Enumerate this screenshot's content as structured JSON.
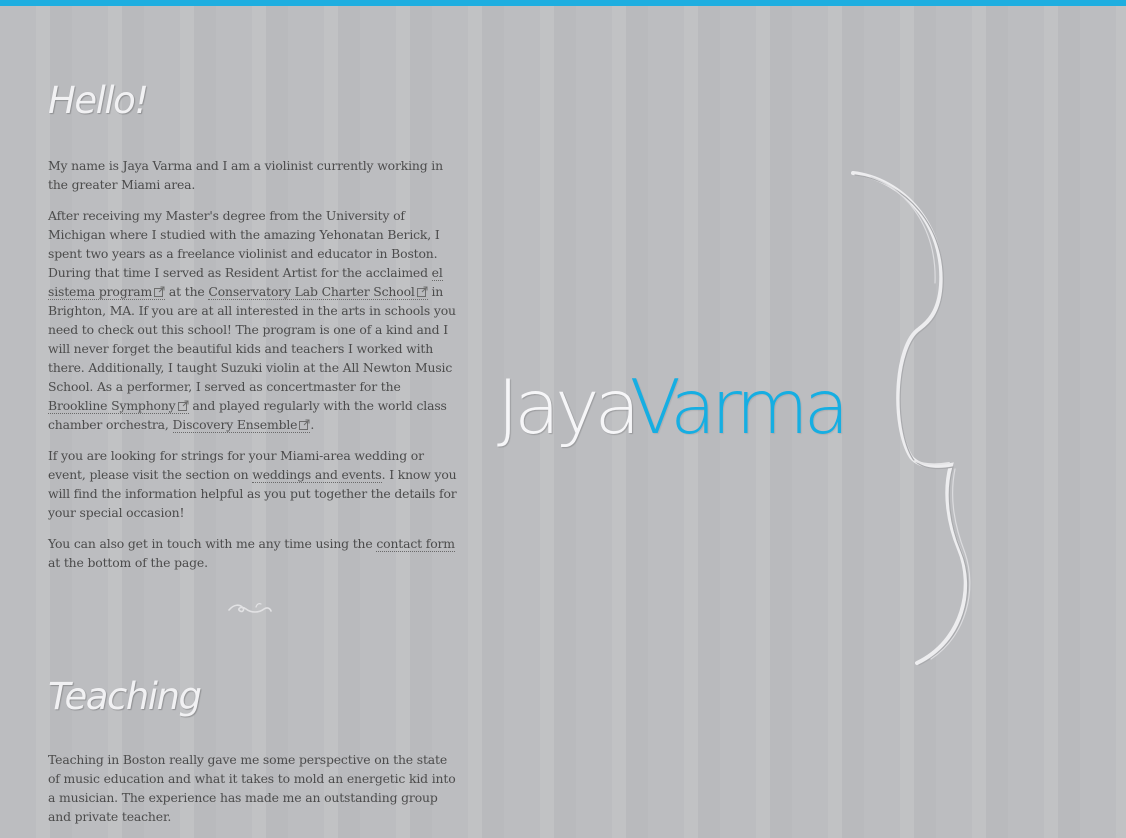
{
  "colors": {
    "accent": "#1eaee0",
    "background": "#bcbdc0",
    "heading": "#f1f1f3",
    "body_text": "#4b4b4b"
  },
  "logo": {
    "first": "Jaya",
    "last": "Varma"
  },
  "hello": {
    "heading": "Hello!",
    "p1": "My name is Jaya Varma and I am a violinist currently working in the greater Miami area.",
    "p2": {
      "t1": "After receiving my Master's degree from the University of Michigan where I studied with the amazing Yehonatan Berick, I spent two years as a freelance violinist and educator in Boston. During that time I served as Resident Artist for the acclaimed ",
      "link1": "el sistema program",
      "t2": " at the ",
      "link2": "Conservatory Lab Charter School",
      "t3": " in Brighton, MA. If you are at all interested in the arts in schools you need to check out this school! The program is one of a kind and I will never forget the beautiful kids and teachers I worked with there. Additionally, I taught Suzuki violin at the All Newton Music School. As a performer, I served as concertmaster for the ",
      "link3": "Brookline Symphony",
      "t4": " and played regularly with the world class chamber orchestra, ",
      "link4": "Discovery Ensemble",
      "t5": "."
    },
    "p3": {
      "t1": "If you are looking for strings for your Miami-area wedding or event, please visit the section on ",
      "link1": "weddings and events",
      "t2": ". I know you will find the information helpful as you put together the details for your special occasion!"
    },
    "p4": {
      "t1": "You can also get in touch with me any time using the ",
      "link1": "contact form",
      "t2": " at the bottom of the page."
    }
  },
  "teaching": {
    "heading": "Teaching",
    "p1": "Teaching in Boston really gave me some perspective on the state of music education and what it takes to mold an energetic kid into a musician. The experience has made me an outstanding group and private teacher."
  },
  "icons": {
    "external": "external-link-icon",
    "ornament": "flourish-ornament",
    "violin": "violin-outline"
  }
}
